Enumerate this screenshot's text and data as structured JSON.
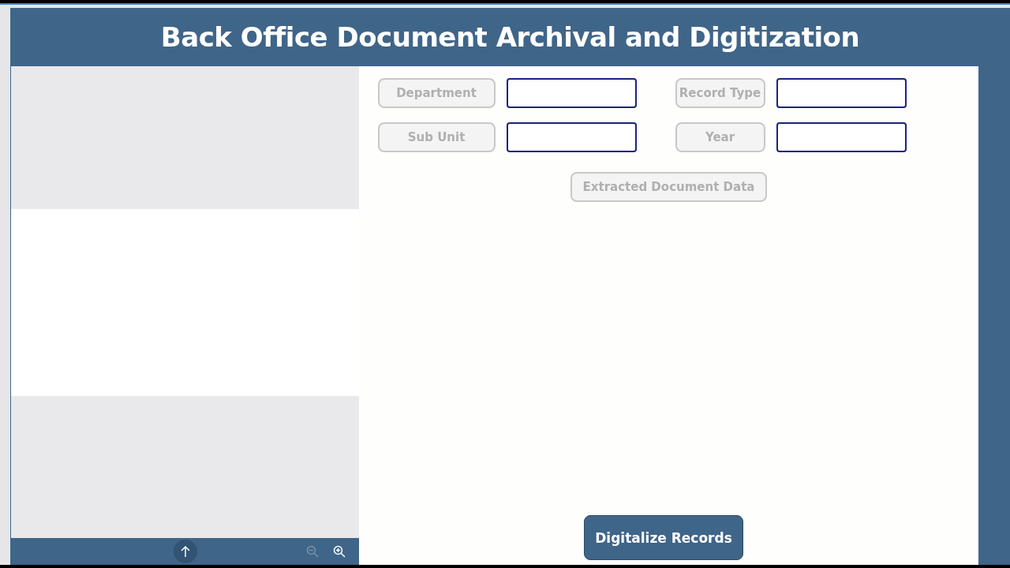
{
  "header": {
    "title": "Back Office Document Archival and Digitization"
  },
  "viewer_toolbar": {
    "controls": [
      {
        "kind": "up",
        "disabled": false
      },
      {
        "kind": "zoom_out",
        "disabled": true
      },
      {
        "kind": "zoom_in",
        "disabled": false
      }
    ]
  },
  "fields": [
    {
      "label": "Department"
    },
    {
      "label": "Record Type"
    },
    {
      "label": "Sub Unit"
    },
    {
      "label": "Year"
    }
  ],
  "extracted_label": "Extracted Document Data",
  "submit_button": "Digitalize Records"
}
